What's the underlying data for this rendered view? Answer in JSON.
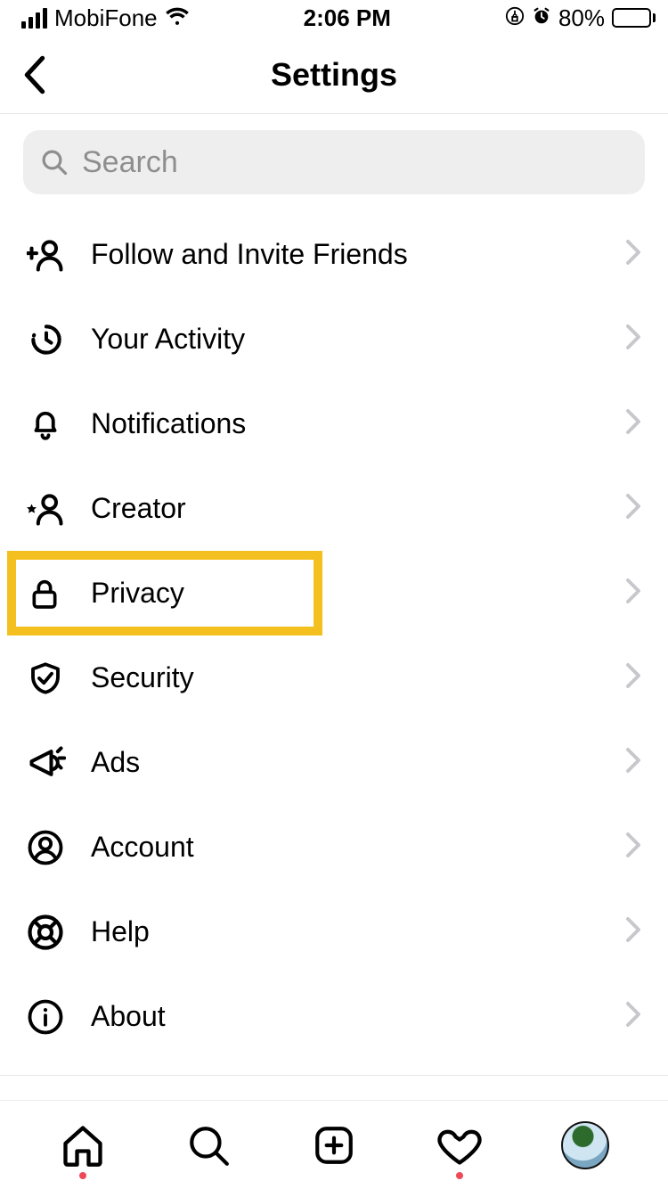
{
  "status": {
    "carrier": "MobiFone",
    "time": "2:06 PM",
    "battery_pct": "80%"
  },
  "nav": {
    "title": "Settings"
  },
  "search": {
    "placeholder": "Search"
  },
  "items": [
    {
      "icon": "add-user-icon",
      "label": "Follow and Invite Friends"
    },
    {
      "icon": "activity-icon",
      "label": "Your Activity"
    },
    {
      "icon": "bell-icon",
      "label": "Notifications"
    },
    {
      "icon": "star-user-icon",
      "label": "Creator"
    },
    {
      "icon": "lock-icon",
      "label": "Privacy",
      "highlighted": true
    },
    {
      "icon": "shield-icon",
      "label": "Security"
    },
    {
      "icon": "megaphone-icon",
      "label": "Ads"
    },
    {
      "icon": "account-icon",
      "label": "Account"
    },
    {
      "icon": "help-icon",
      "label": "Help"
    },
    {
      "icon": "info-icon",
      "label": "About"
    }
  ],
  "tabs": {
    "home_dot": true,
    "activity_dot": true
  }
}
